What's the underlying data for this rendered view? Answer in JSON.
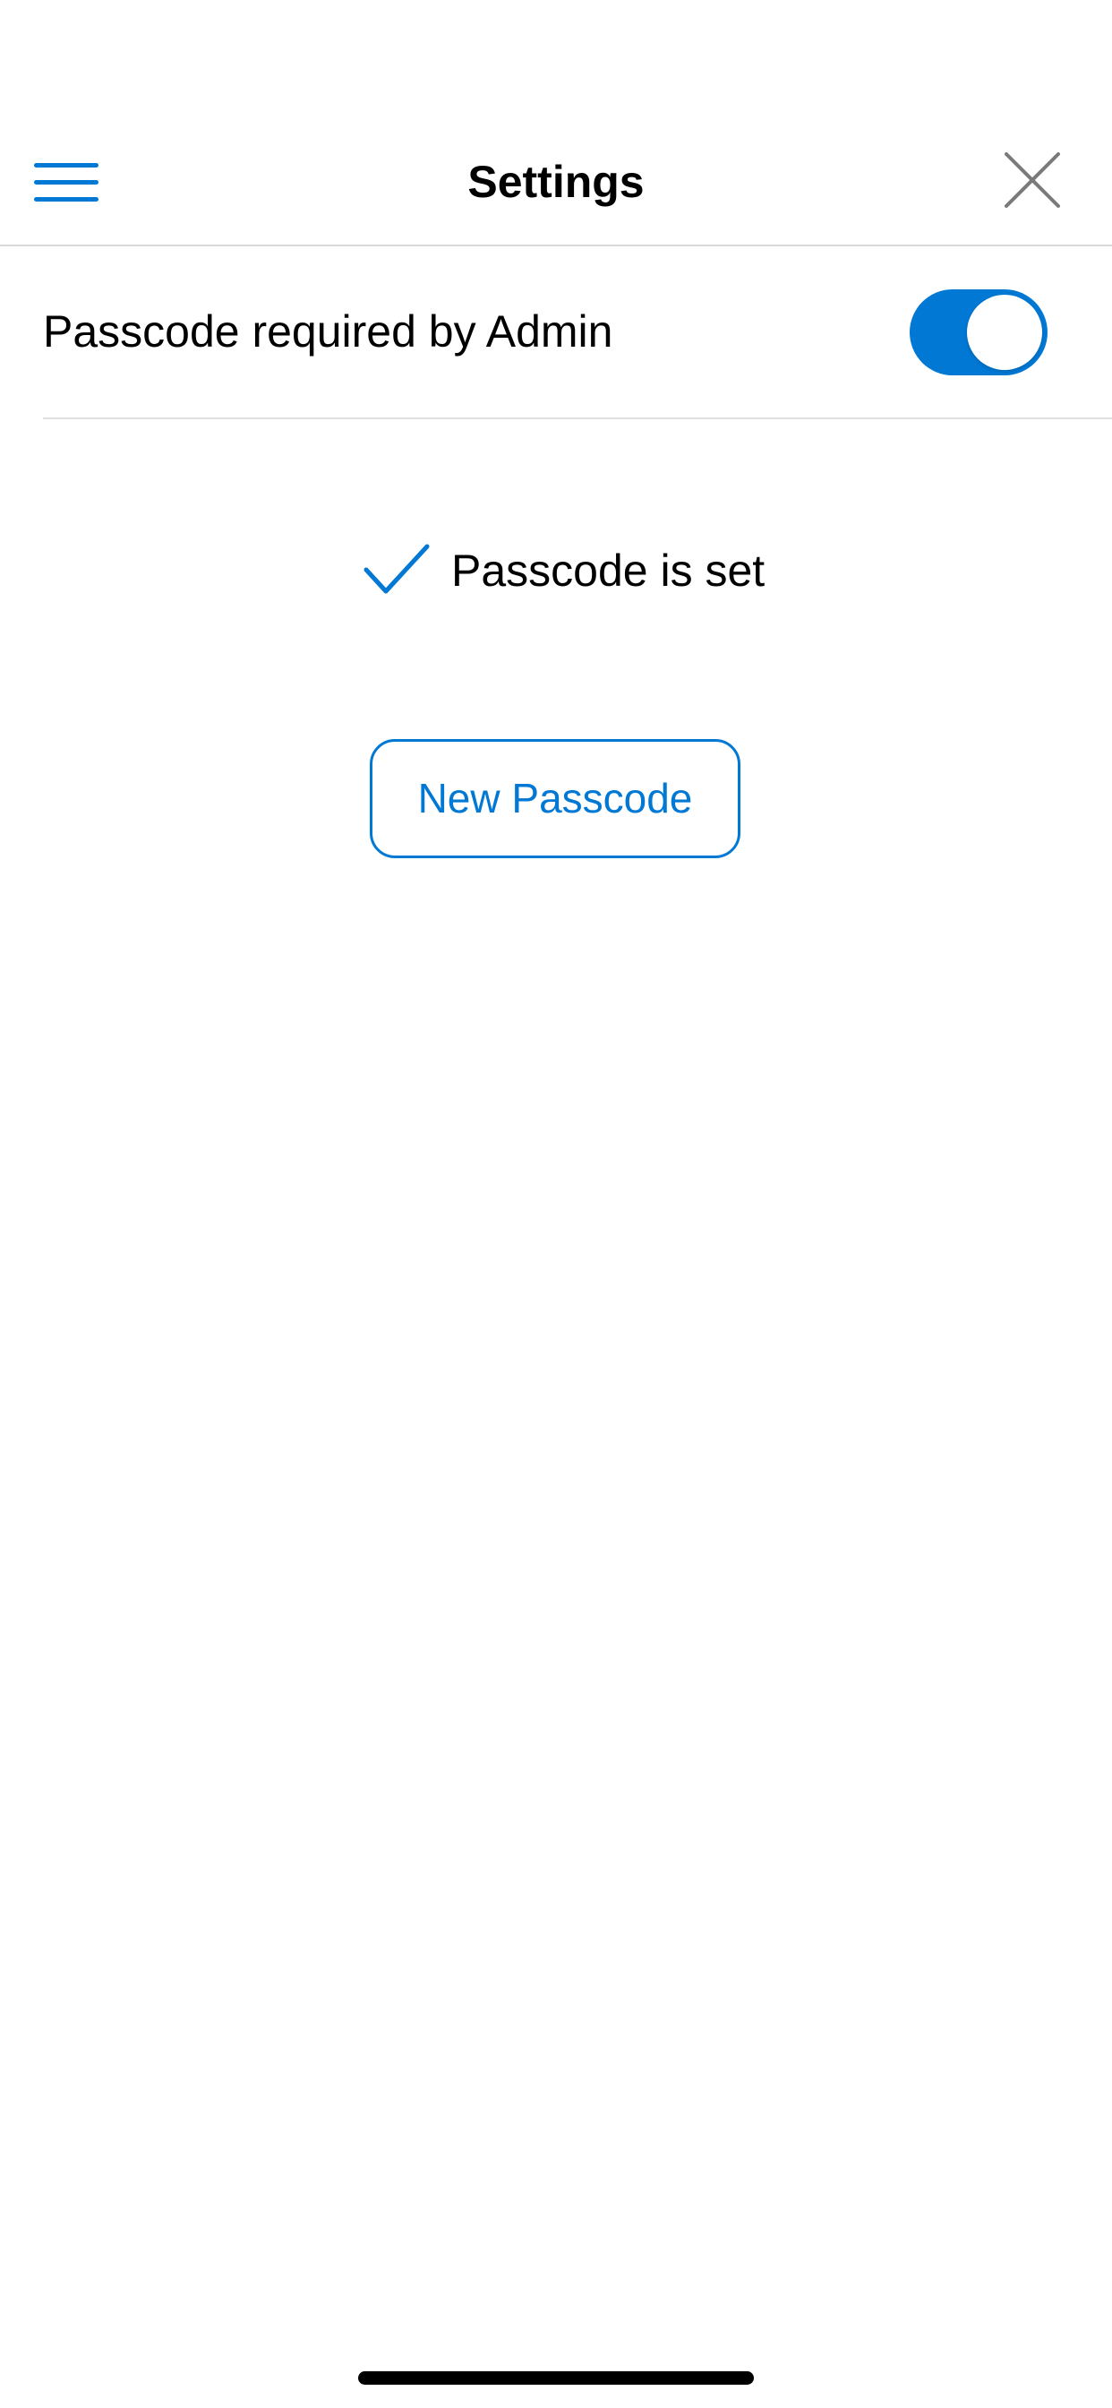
{
  "header": {
    "title": "Settings",
    "menu_icon": "hamburger-menu-icon",
    "close_icon": "close-icon"
  },
  "settings": {
    "passcode_required": {
      "label": "Passcode required by Admin",
      "enabled": true
    }
  },
  "status": {
    "icon": "checkmark-icon",
    "text": "Passcode is set"
  },
  "actions": {
    "new_passcode_label": "New Passcode"
  },
  "colors": {
    "accent": "#0078d4",
    "divider": "#d9d9d9",
    "close_icon": "#7a7a7a"
  }
}
